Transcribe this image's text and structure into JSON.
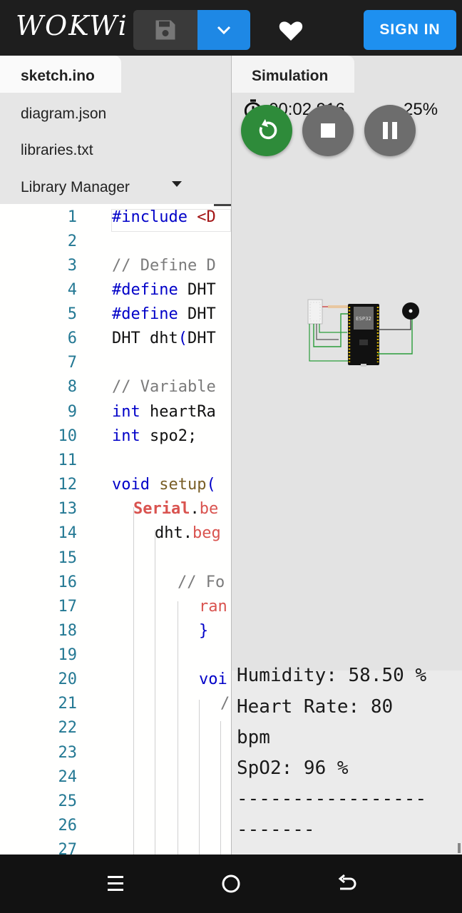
{
  "header": {
    "logo": "WOKWi",
    "save_icon": "floppy-disk-icon",
    "dropdown_icon": "caret-down-icon",
    "heart_icon": "heart-icon",
    "signin_label": "SIGN IN",
    "accent": "#1e88e5"
  },
  "file_tabs": {
    "active": "sketch.ino",
    "items": [
      "diagram.json",
      "libraries.txt",
      "Library Manager"
    ]
  },
  "editor": {
    "line_numbers": [
      "1",
      "2",
      "3",
      "4",
      "5",
      "6",
      "7",
      "8",
      "9",
      "10",
      "11",
      "12",
      "13",
      "14",
      "15",
      "16",
      "17",
      "18",
      "19",
      "20",
      "21",
      "22",
      "23",
      "24",
      "25",
      "26",
      "27"
    ],
    "lines": {
      "l1_kw": "#include",
      "l1_str": " <D",
      "l3": "// Define D",
      "l4_kw": "#define",
      "l4_rest": " DHT",
      "l5_kw": "#define",
      "l5_rest": " DHT",
      "l6_a": "DHT dht",
      "l6_b": "(",
      "l6_c": "DHT",
      "l8": "// Variable",
      "l9_kw": "int",
      "l9_rest": " heartRa",
      "l10_kw": "int",
      "l10_rest": " spo2;",
      "l12_kw": "void",
      "l12_fn": " setup",
      "l12_paren": "(",
      "l13_ser": "Serial",
      "l13_rest": ".",
      "l13_fn": "be",
      "l14_a": "dht.",
      "l14_fn": "beg",
      "l16": "// Fo",
      "l17": "ran",
      "l18": "}",
      "l20": "voi",
      "l21": "/"
    }
  },
  "simulation": {
    "tab_label": "Simulation",
    "timer_icon": "stopwatch-icon",
    "elapsed": "00:02.916",
    "speed_icon": "speedometer-icon",
    "speed": "25%",
    "restart_icon": "restart-icon",
    "stop_icon": "stop-icon",
    "pause_icon": "pause-icon",
    "colors": {
      "restart": "#2e8b3a",
      "stop": "#6d6d6d",
      "pause": "#6d6d6d"
    },
    "board_label": "ESP32"
  },
  "serial_monitor": {
    "lines": [
      "Humidity: 58.50 %",
      "Heart Rate: 80",
      "bpm",
      "SpO2: 96 %",
      "-----------------",
      "-------"
    ]
  },
  "navbar": {
    "menu_icon": "menu-icon",
    "home_icon": "home-circle-icon",
    "back_icon": "back-icon"
  }
}
